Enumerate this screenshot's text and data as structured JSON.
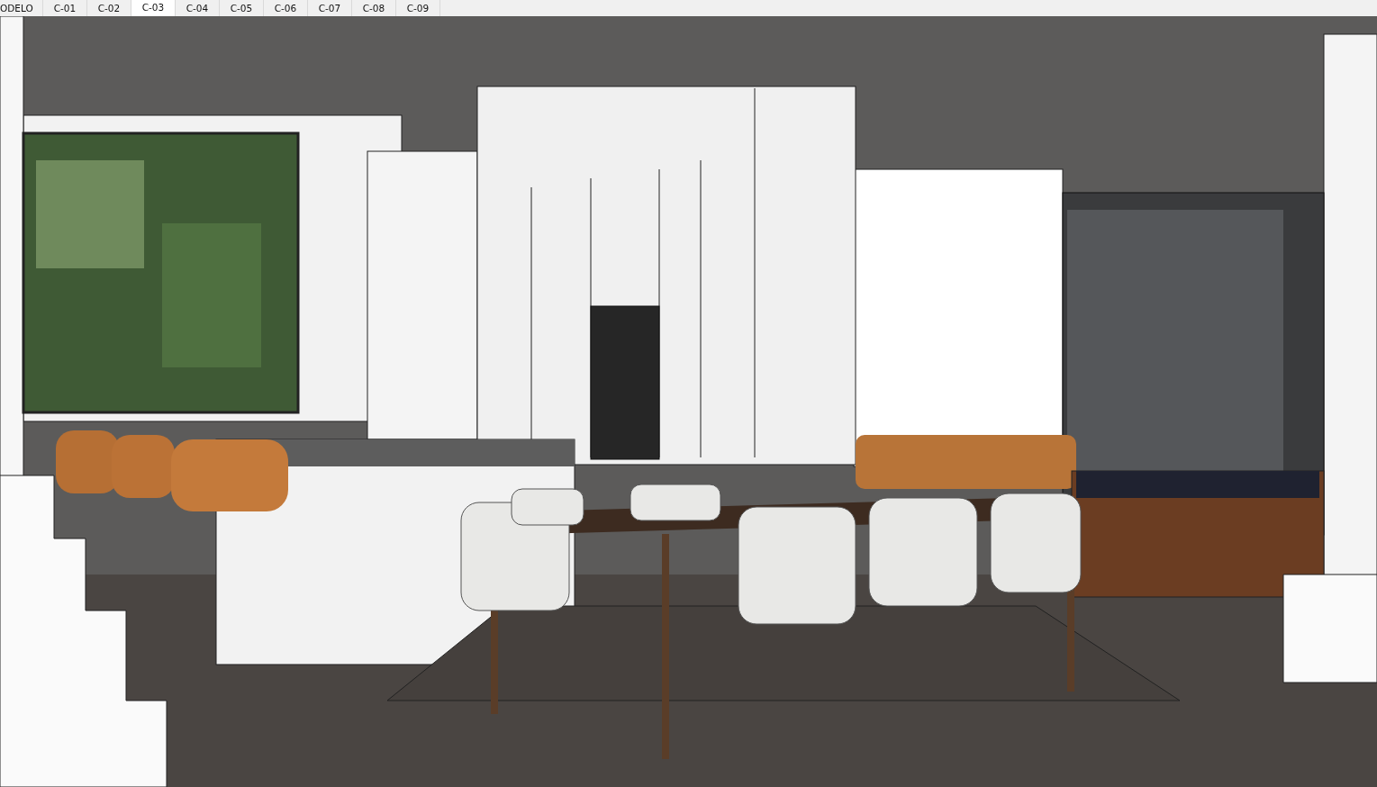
{
  "scene_tabs": [
    {
      "label": "ODELO",
      "selected": false
    },
    {
      "label": "C-01",
      "selected": false
    },
    {
      "label": "C-02",
      "selected": false
    },
    {
      "label": "C-03",
      "selected": true
    },
    {
      "label": "C-04",
      "selected": false
    },
    {
      "label": "C-05",
      "selected": false
    },
    {
      "label": "C-06",
      "selected": false
    },
    {
      "label": "C-07",
      "selected": false
    },
    {
      "label": "C-08",
      "selected": false
    },
    {
      "label": "C-09",
      "selected": false
    }
  ]
}
